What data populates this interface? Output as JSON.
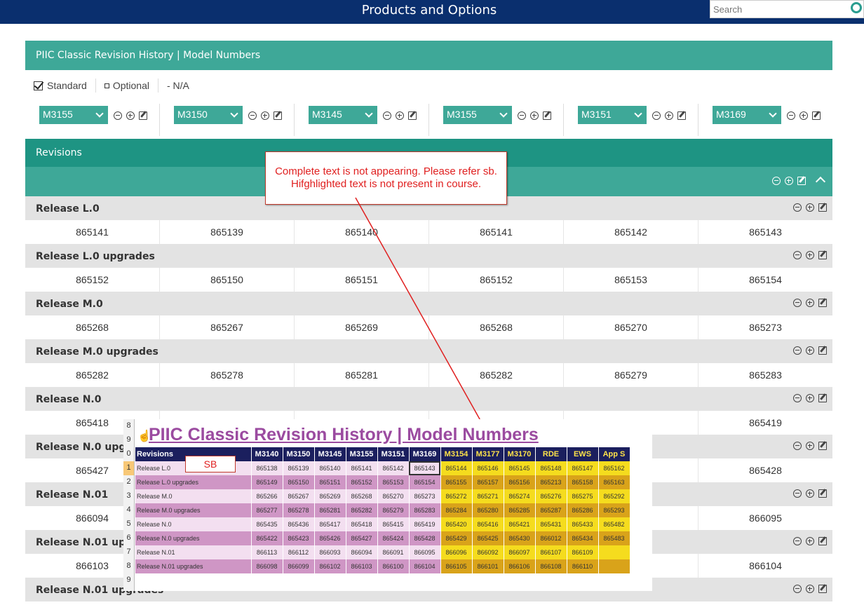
{
  "header": {
    "title": "Products and Options",
    "search_placeholder": "Search"
  },
  "panel": {
    "title": "PIIC Classic Revision History | Model Numbers"
  },
  "legend": {
    "standard": "Standard",
    "optional": "Optional",
    "na": "- N/A"
  },
  "selectors": [
    "M3155",
    "M3150",
    "M3145",
    "M3155",
    "M3151",
    "M3169"
  ],
  "revisions": {
    "title": "Revisions"
  },
  "releases": [
    {
      "name": "Release L.0",
      "values": [
        "865141",
        "865139",
        "865140",
        "865141",
        "865142",
        "865143"
      ]
    },
    {
      "name": "Release L.0 upgrades",
      "values": [
        "865152",
        "865150",
        "865151",
        "865152",
        "865153",
        "865154"
      ]
    },
    {
      "name": "Release M.0",
      "values": [
        "865268",
        "865267",
        "865269",
        "865268",
        "865270",
        "865273"
      ]
    },
    {
      "name": "Release M.0 upgrades",
      "values": [
        "865282",
        "865278",
        "865281",
        "865282",
        "865279",
        "865283"
      ]
    },
    {
      "name": "Release N.0",
      "values": [
        "865418",
        "",
        "",
        "",
        "",
        "865419"
      ]
    },
    {
      "name": "Release N.0 upgrad",
      "values": [
        "865427",
        "",
        "",
        "",
        "",
        "865428"
      ]
    },
    {
      "name": "Release N.01",
      "values": [
        "866094",
        "",
        "",
        "",
        "",
        "866095"
      ]
    },
    {
      "name": "Release N.01 upgra",
      "values": [
        "866103",
        "",
        "",
        "",
        "",
        "866104"
      ]
    },
    {
      "name": "Release N.01 upgrades",
      "values": [
        "",
        "",
        "",
        "",
        "",
        ""
      ]
    }
  ],
  "callout": {
    "text": "Complete text is not appearing. Please refer sb. Hifghlighted text is not present in course."
  },
  "spreadsheet": {
    "title": "PIIC Classic Revision History | Model Numbers",
    "sb_label": "SB",
    "gutter": [
      "8",
      "9",
      "0",
      "1",
      "2",
      "3",
      "4",
      "5",
      "6",
      "7",
      "8",
      "9"
    ],
    "headers": [
      "Revisions",
      "M3140",
      "M3150",
      "M3145",
      "M3155",
      "M3151",
      "M3169",
      "M3154",
      "M3177",
      "M3170",
      "RDE",
      "EWS",
      "App S"
    ],
    "rows": [
      [
        "Release L.0",
        "865138",
        "865139",
        "865140",
        "865141",
        "865142",
        "865143",
        "865144",
        "865146",
        "865145",
        "865148",
        "865147",
        "865162"
      ],
      [
        "Release L.0 upgrades",
        "865149",
        "865150",
        "865151",
        "865152",
        "865153",
        "865154",
        "865155",
        "865157",
        "865156",
        "865213",
        "865158",
        "865163"
      ],
      [
        "Release M.0",
        "865266",
        "865267",
        "865269",
        "865268",
        "865270",
        "865273",
        "865272",
        "865271",
        "865274",
        "865276",
        "865275",
        "865292"
      ],
      [
        "Release M.0 upgrades",
        "865277",
        "865278",
        "865281",
        "865282",
        "865279",
        "865283",
        "865284",
        "865280",
        "865285",
        "865287",
        "865286",
        "865293"
      ],
      [
        "Release N.0",
        "865435",
        "865436",
        "865417",
        "865418",
        "865415",
        "865419",
        "865420",
        "865416",
        "865421",
        "865431",
        "865433",
        "865482"
      ],
      [
        "Release N.0 upgrades",
        "865422",
        "865423",
        "865426",
        "865427",
        "865424",
        "865428",
        "865429",
        "865425",
        "865430",
        "866012",
        "865434",
        "865483"
      ],
      [
        "Release N.01",
        "866113",
        "866112",
        "866093",
        "866094",
        "866091",
        "866095",
        "866096",
        "866092",
        "866097",
        "866107",
        "866109",
        ""
      ],
      [
        "Release N.01 upgrades",
        "866098",
        "866099",
        "866102",
        "866103",
        "866100",
        "866104",
        "866105",
        "866101",
        "866106",
        "866108",
        "866110",
        ""
      ]
    ]
  }
}
